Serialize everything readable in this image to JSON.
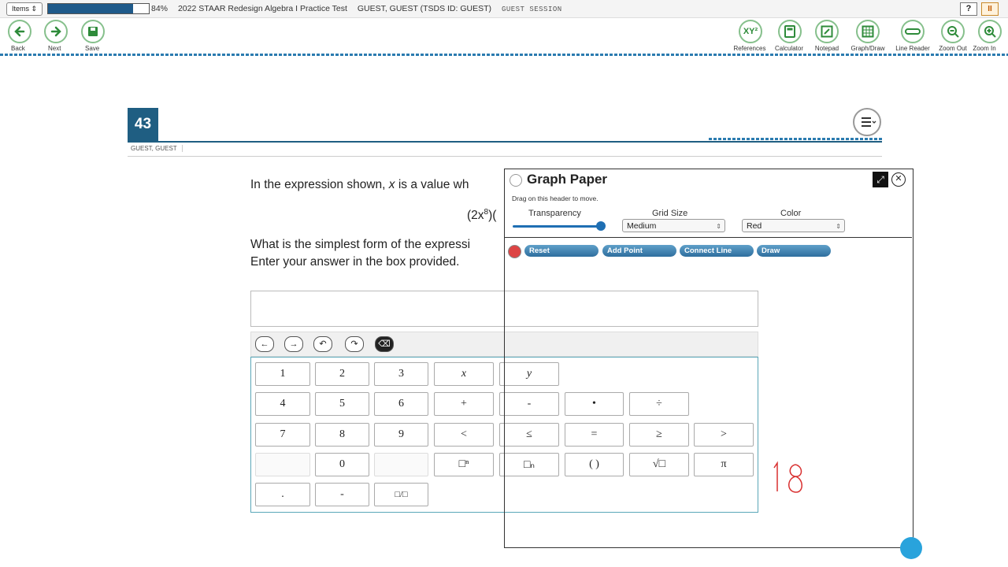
{
  "top_bar": {
    "items_button": "Items",
    "progress_label": "84%",
    "progress_fraction": 0.84,
    "test_title": "2022 STAAR Redesign Algebra I Practice Test",
    "student": "GUEST, GUEST (TSDS ID: GUEST)",
    "session": "GUEST SESSION",
    "help": "?",
    "pause": "II"
  },
  "nav": {
    "back": "Back",
    "next": "Next",
    "save": "Save"
  },
  "tools": {
    "references": "References",
    "calculator": "Calculator",
    "notepad": "Notepad",
    "graph_draw": "Graph/Draw",
    "line_reader": "Line Reader",
    "zoom_out": "Zoom Out",
    "zoom_in": "Zoom In"
  },
  "question": {
    "number": "43",
    "student_tag": "GUEST, GUEST",
    "text1_pre": "In the expression shown, ",
    "text1_var": "x",
    "text1_post": " is a value wh",
    "expr_base": "(2x",
    "expr_exp": "8",
    "expr_tail": ")(",
    "text2": "What is the simplest form of the expressi",
    "text3": "Enter your answer in the box provided."
  },
  "editor_toolbar": [
    "←",
    "→",
    "↶",
    "↷",
    "⌫"
  ],
  "keypad": {
    "row1": [
      "1",
      "2",
      "3",
      "x",
      "y"
    ],
    "row2": [
      "4",
      "5",
      "6",
      "+",
      "-",
      "•",
      "÷"
    ],
    "row3": [
      "7",
      "8",
      "9",
      "<",
      "≤",
      "=",
      "≥",
      ">"
    ],
    "row4": [
      "0",
      "□ⁿ",
      "□ₙ",
      "( )",
      "√□",
      "π"
    ],
    "row5": [
      ".",
      "-",
      "□/□"
    ]
  },
  "graph_paper": {
    "title": "Graph Paper",
    "hint": "Drag on this header to move.",
    "transparency_label": "Transparency",
    "transparency_value": 0.95,
    "grid_size_label": "Grid Size",
    "grid_size_value": "Medium",
    "color_label": "Color",
    "color_value": "Red",
    "buttons": {
      "reset": "Reset",
      "add_point": "Add Point",
      "connect_line": "Connect Line",
      "draw": "Draw"
    }
  },
  "handwriting": "18",
  "colors": {
    "accent": "#1f5e82",
    "tool_ring": "#86c08c",
    "ink": "#d93030"
  }
}
